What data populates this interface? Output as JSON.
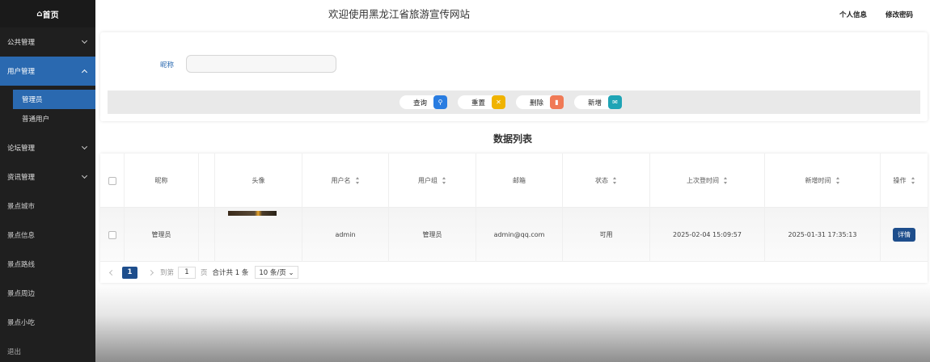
{
  "sidebar": {
    "brand": "首页",
    "menu": [
      {
        "label": "公共管理"
      },
      {
        "label": "用户管理",
        "sub": [
          "管理员",
          "普通用户"
        ]
      },
      {
        "label": "论坛管理"
      },
      {
        "label": "资讯管理"
      },
      {
        "label": "景点城市"
      },
      {
        "label": "景点信息"
      },
      {
        "label": "景点路线"
      },
      {
        "label": "景点周边"
      },
      {
        "label": "景点小吃"
      },
      {
        "label": "退出"
      }
    ]
  },
  "header": {
    "title": "欢迎使用黑龙江省旅游宣传网站",
    "profile": "个人信息",
    "password": "修改密码"
  },
  "search": {
    "label": "昵称",
    "placeholder": "",
    "buttons": {
      "query": "查询",
      "reset": "重置",
      "delete": "删除",
      "add": "新增"
    }
  },
  "list": {
    "title": "数据列表",
    "columns": [
      "昵称",
      "头像",
      "用户名",
      "用户组",
      "邮箱",
      "状态",
      "上次登时间",
      "新增时间",
      "操作"
    ],
    "rows": [
      {
        "nickname": "管理员",
        "username": "admin",
        "group": "管理员",
        "email": "admin@qq.com",
        "status": "可用",
        "last_login": "2025-02-04 15:09:57",
        "created": "2025-01-31 17:35:13",
        "action": "详情"
      }
    ]
  },
  "pager": {
    "current": "1",
    "goto_label": "到第",
    "goto_value": "1",
    "page_label": "页",
    "total": "合计共 1 条",
    "page_size": "10 条/页"
  },
  "colors": {
    "sidebar_bg": "#1f1f1f",
    "accent": "#2a69b0",
    "query_icon": "#2a7de1",
    "reset_icon": "#f0b300",
    "delete_icon": "#f07a56",
    "add_icon": "#1fa4b5"
  }
}
